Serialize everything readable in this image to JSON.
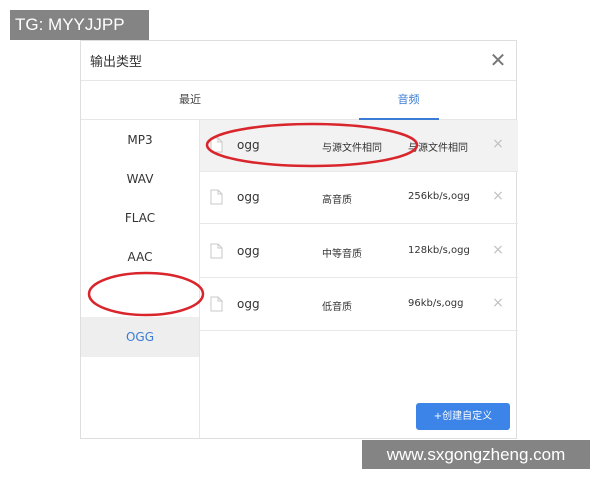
{
  "watermark_top": "TG: MYYJJPP",
  "watermark_bottom": "www.sxgongzheng.com",
  "dialog": {
    "title": "输出类型",
    "close_icon": "close-icon",
    "tabs": [
      {
        "label": "最近"
      },
      {
        "label": "音频",
        "active": true
      }
    ],
    "formats": [
      {
        "label": "MP3"
      },
      {
        "label": "WAV"
      },
      {
        "label": "FLAC"
      },
      {
        "label": "AAC"
      },
      {
        "label": "OGG",
        "active": true
      }
    ],
    "presets": [
      {
        "format": "ogg",
        "quality": "与源文件相同",
        "detail": "与源文件相同",
        "selected": true
      },
      {
        "format": "ogg",
        "quality": "高音质",
        "detail": "256kb/s,ogg"
      },
      {
        "format": "ogg",
        "quality": "中等音质",
        "detail": "128kb/s,ogg"
      },
      {
        "format": "ogg",
        "quality": "低音质",
        "detail": "96kb/s,ogg"
      }
    ],
    "remove_glyph": "×",
    "create_button": "+创建自定义"
  },
  "colors": {
    "accent": "#3a7bd5",
    "button": "#3d84e8",
    "annotation": "#d9262c"
  }
}
